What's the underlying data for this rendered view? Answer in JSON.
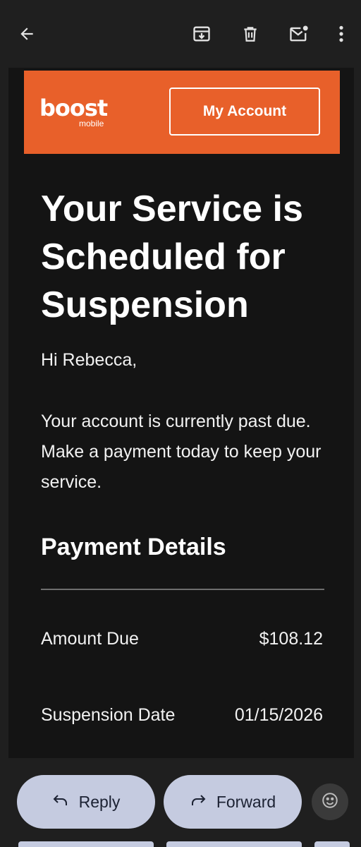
{
  "toolbar": {
    "back_icon": "arrow-left-icon",
    "archive_icon": "archive-icon",
    "delete_icon": "trash-icon",
    "mark_unread_icon": "mail-unread-icon",
    "more_icon": "more-vert-icon"
  },
  "email": {
    "brand": {
      "logo_word": "boost",
      "logo_sub": "mobile",
      "color": "#e8602a"
    },
    "account_button": "My Account",
    "headline": "Your Service is Scheduled for Suspension",
    "greeting": "Hi Rebecca,",
    "body": "Your account is currently past due. Make a payment today to keep your service.",
    "section_title": "Payment Details",
    "details": [
      {
        "label": "Amount Due",
        "value": "$108.12"
      },
      {
        "label": "Suspension Date",
        "value": "01/15/2026"
      }
    ]
  },
  "actions": {
    "reply": "Reply",
    "forward": "Forward",
    "emoji_icon": "emoji-smile-icon",
    "pill_color": "#c5cbe0"
  }
}
